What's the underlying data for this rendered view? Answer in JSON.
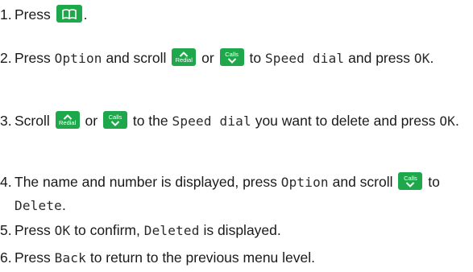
{
  "steps": [
    {
      "num": "1.",
      "a": "Press"
    },
    {
      "num": "2.",
      "a": "Press",
      "option": "Option",
      "b": "and scroll",
      "or": "or",
      "c": "to",
      "speed_dial": "Speed dial",
      "d": "and press",
      "ok": "OK",
      "e": "."
    },
    {
      "num": "3.",
      "a": "Scroll",
      "or": "or",
      "b": "to the",
      "speed_dial": "Speed dial",
      "c": "you want to delete and press",
      "ok": "OK",
      "d": "."
    },
    {
      "num": "4.",
      "a": "The name and number is displayed, press",
      "option": "Option",
      "b": "and scroll",
      "c": "to",
      "delete": "Delete",
      "d": "."
    },
    {
      "num": "5.",
      "a": "Press",
      "ok": "OK",
      "b": "to confirm,",
      "deleted": "Deleted",
      "c": "is displayed."
    },
    {
      "num": "6.",
      "a": "Press",
      "back": "Back",
      "b": "to return to the previous menu level."
    }
  ],
  "keys": {
    "redial_label": "Redial",
    "calls_label": "Calls",
    "color": "#1ea84b"
  },
  "icons": {
    "phonebook": "phonebook-icon",
    "up": "chevron-up-icon",
    "down": "chevron-down-icon"
  }
}
